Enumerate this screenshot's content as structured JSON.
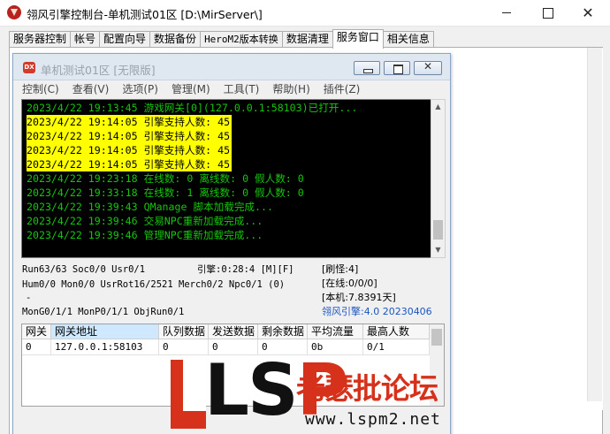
{
  "window": {
    "title": "翎风引擎控制台-单机测试01区 [D:\\MirServer\\]",
    "minimize_glyph": "",
    "maximize_glyph": "",
    "close_glyph": "✕"
  },
  "tabs": [
    {
      "label": "服务器控制"
    },
    {
      "label": "帐号"
    },
    {
      "label": "配置向导"
    },
    {
      "label": "数据备份"
    },
    {
      "label": "HeroM2版本转换"
    },
    {
      "label": "数据清理"
    },
    {
      "label": "服务窗口",
      "active": true
    },
    {
      "label": "相关信息"
    }
  ],
  "child": {
    "icon_text": "DX",
    "title": "单机测试01区 [无限版]",
    "close_glyph": "✕",
    "menu": [
      "控制(C)",
      "查看(V)",
      "选项(P)",
      "管理(M)",
      "工具(T)",
      "帮助(H)",
      "插件(Z)"
    ]
  },
  "console": {
    "lines": [
      {
        "text": "2023/4/22 19:13:45 游戏网关[0](127.0.0.1:58103)已打开...",
        "highlight": false
      },
      {
        "text": "2023/4/22 19:14:05 引擎支持人数: 45",
        "highlight": true
      },
      {
        "text": "2023/4/22 19:14:05 引擎支持人数: 45",
        "highlight": true
      },
      {
        "text": "2023/4/22 19:14:05 引擎支持人数: 45",
        "highlight": true
      },
      {
        "text": "2023/4/22 19:14:05 引擎支持人数: 45",
        "highlight": true
      },
      {
        "text": "2023/4/22 19:23:18 在线数: 0 离线数: 0 假人数: 0",
        "highlight": false
      },
      {
        "text": "2023/4/22 19:33:18 在线数: 1 离线数: 0 假人数: 0",
        "highlight": false
      },
      {
        "text": "2023/4/22 19:39:43 QManage 脚本加载完成...",
        "highlight": false
      },
      {
        "text": "2023/4/22 19:39:46 交易NPC重新加载完成...",
        "highlight": false
      },
      {
        "text": "2023/4/22 19:39:46 管理NPC重新加载完成...",
        "highlight": false
      }
    ]
  },
  "status": {
    "left1": "Run63/63 Soc0/0 Usr0/1",
    "engine": "引擎:0:28:4 [M][F]",
    "left2": "Hum0/0 Mon0/0 UsrRot16/2521 Merch0/2 Npc0/1 (0)",
    "left3": "-",
    "left4": "MonG0/1/1 MonP0/1/1 ObjRun0/1",
    "refresh": "[刷怪:4]",
    "online": "[在线:0/0/0]",
    "local": "[本机:7.8391天]",
    "version": "翎风引擎:4.0 20230406"
  },
  "gateway_table": {
    "headers": [
      "网关",
      "网关地址",
      "队列数据",
      "发送数据",
      "剩余数据",
      "平均流量",
      "最高人数"
    ],
    "rows": [
      [
        "0",
        "127.0.0.1:58103",
        "0",
        "0",
        "0",
        "0b",
        "0/1"
      ]
    ]
  },
  "watermark": {
    "brand": "LSP",
    "chinese": "老瑟批论坛",
    "url": "www.lspm2.net"
  }
}
